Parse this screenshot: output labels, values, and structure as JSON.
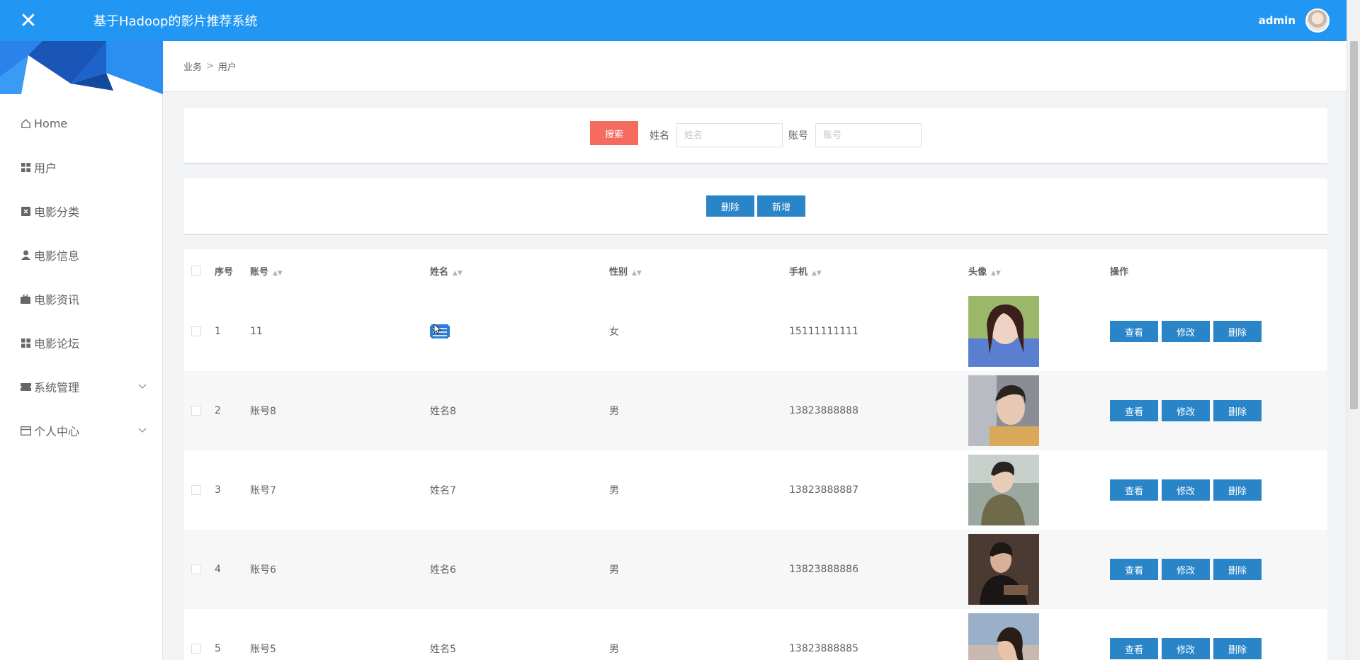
{
  "header": {
    "title": "基于Hadoop的影片推荐系统",
    "username": "admin"
  },
  "sidebar": {
    "items": [
      {
        "label": "Home",
        "icon": "home-icon"
      },
      {
        "label": "用户",
        "icon": "grid-icon"
      },
      {
        "label": "电影分类",
        "icon": "clipboard-icon"
      },
      {
        "label": "电影信息",
        "icon": "user-icon"
      },
      {
        "label": "电影资讯",
        "icon": "briefcase-icon"
      },
      {
        "label": "电影论坛",
        "icon": "grid-icon"
      },
      {
        "label": "系统管理",
        "icon": "ticket-icon",
        "expandable": true
      },
      {
        "label": "个人中心",
        "icon": "card-icon",
        "expandable": true
      }
    ]
  },
  "breadcrumb": {
    "parent": "业务",
    "separator": ">",
    "current": "用户"
  },
  "search": {
    "button_label": "搜索",
    "name_label": "姓名",
    "name_placeholder": "姓名",
    "account_label": "账号",
    "account_placeholder": "账号"
  },
  "actions": {
    "delete_label": "删除",
    "add_label": "新增"
  },
  "table": {
    "headers": {
      "index": "序号",
      "account": "账号",
      "name": "姓名",
      "sex": "性别",
      "phone": "手机",
      "avatar": "头像",
      "ops": "操作"
    },
    "op_labels": {
      "view": "查看",
      "edit": "修改",
      "delete": "删除"
    },
    "rows": [
      {
        "index": "1",
        "account": "11",
        "name": "",
        "sex": "女",
        "phone": "15111111111"
      },
      {
        "index": "2",
        "account": "账号8",
        "name": "姓名8",
        "sex": "男",
        "phone": "13823888888"
      },
      {
        "index": "3",
        "account": "账号7",
        "name": "姓名7",
        "sex": "男",
        "phone": "13823888887"
      },
      {
        "index": "4",
        "account": "账号6",
        "name": "姓名6",
        "sex": "男",
        "phone": "13823888886"
      },
      {
        "index": "5",
        "account": "账号5",
        "name": "姓名5",
        "sex": "男",
        "phone": "13823888885"
      }
    ]
  },
  "colors": {
    "header_bg": "#2196f3",
    "primary_button": "#2a84c8",
    "search_button": "#f66b60"
  }
}
